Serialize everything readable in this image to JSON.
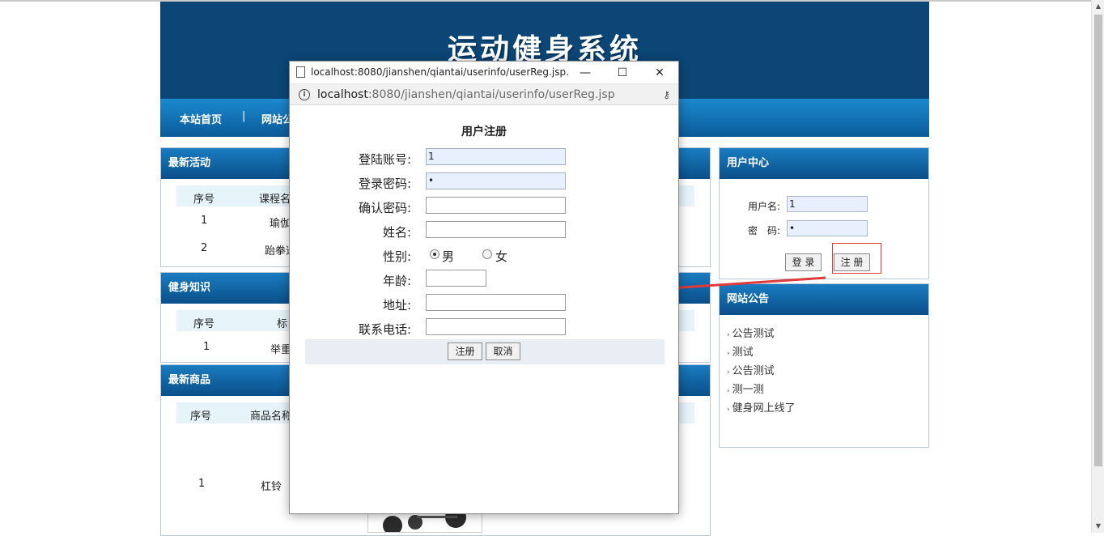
{
  "site": {
    "title": "运动健身系统",
    "nav": [
      "本站首页",
      "|",
      "网站公"
    ],
    "panels": {
      "activities": {
        "title": "最新活动",
        "headers": [
          "序号",
          "课程名"
        ],
        "rows": [
          [
            "1",
            "瑜伽"
          ],
          [
            "2",
            "跆拳道"
          ]
        ]
      },
      "knowledge": {
        "title": "健身知识",
        "headers": [
          "序号",
          "标"
        ],
        "rows": [
          [
            "1",
            "举重"
          ]
        ]
      },
      "products": {
        "title": "最新商品",
        "headers": [
          "序号",
          "商品名称"
        ],
        "rows": [
          [
            "1",
            "杠铃"
          ]
        ]
      }
    },
    "user_center": {
      "title": "用户中心",
      "username_label": "用户名:",
      "username_value": "1",
      "password_label": "密　码:",
      "password_value": "•",
      "login_button": "登 录",
      "register_button": "注 册"
    },
    "notices": {
      "title": "网站公告",
      "items": [
        "公告测试",
        "测试",
        "公告测试",
        "测一测",
        "健身网上线了"
      ]
    }
  },
  "popup": {
    "window_title": "localhost:8080/jianshen/qiantai/userinfo/userReg.jsp...",
    "minimize": "—",
    "maximize": "☐",
    "close": "✕",
    "url_host": "localhost",
    "url_rest": ":8080/jianshen/qiantai/userinfo/userReg.jsp",
    "form": {
      "title": "用户注册",
      "fields": [
        {
          "label": "登陆账号:",
          "value": "1"
        },
        {
          "label": "登录密码:",
          "value": "•"
        },
        {
          "label": "确认密码:",
          "value": ""
        },
        {
          "label": "姓名:",
          "value": ""
        },
        {
          "label": "性别:",
          "value": ""
        },
        {
          "label": "年龄:",
          "value": ""
        },
        {
          "label": "地址:",
          "value": ""
        },
        {
          "label": "联系电话:",
          "value": ""
        }
      ],
      "gender_options": [
        "男",
        "女"
      ],
      "gender_selected": "男",
      "submit_button": "注册",
      "cancel_button": "取消"
    }
  },
  "colors": {
    "banner": "#0b4677",
    "panel_head": "#1a7cc0",
    "annotation_red": "#e03a3a"
  }
}
